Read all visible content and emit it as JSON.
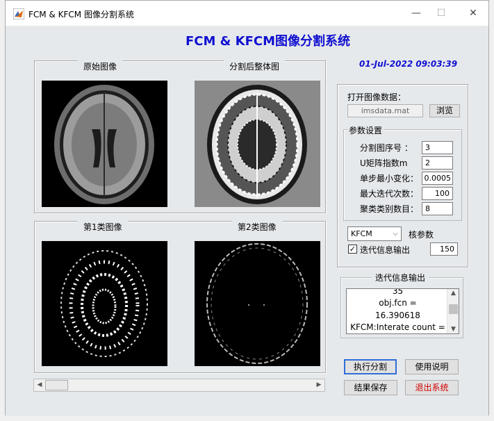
{
  "window": {
    "title": "FCM & KFCM 图像分割系统",
    "minimize": "—",
    "maximize": "☐",
    "close": "✕"
  },
  "app_title": "FCM & KFCM图像分割系统",
  "datetime": "01-Jul-2022 09:03:39",
  "images": {
    "original_label": "原始图像",
    "segmented_label": "分割后整体图",
    "class1_label": "第1类图像",
    "class2_label": "第2类图像"
  },
  "open_data": {
    "label": "打开图像数据：",
    "file_value": "imsdata.mat",
    "browse_label": "浏览"
  },
  "params": {
    "legend": "参数设置",
    "fields": [
      {
        "label": "分割图序号 ：",
        "value": "3"
      },
      {
        "label": "U矩阵指数m",
        "value": "2"
      },
      {
        "label": "单步最小变化：",
        "value": "0.0005"
      },
      {
        "label": "最大迭代次数：",
        "value": "100"
      },
      {
        "label": "聚类类别数目：",
        "value": "8"
      }
    ]
  },
  "kernel": {
    "selected": "KFCM",
    "label": "核参数",
    "output_checkbox_label": "迭代信息输出",
    "output_checked": true,
    "param_value": "150"
  },
  "iteration_output": {
    "legend": "迭代信息输出",
    "lines": [
      "35",
      "obj.fcn =",
      "16.390618",
      "KFCM:Interate count ="
    ]
  },
  "buttons": {
    "run": "执行分割",
    "help": "使用说明",
    "save": "结果保存",
    "exit": "退出系统"
  },
  "colors": {
    "title_blue": "#1010d0",
    "exit_red": "#d00000",
    "focus_blue": "#2f6fd6"
  }
}
